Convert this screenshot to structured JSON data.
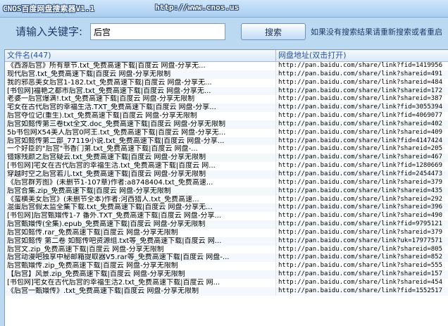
{
  "window": {
    "title": "CNOS百度网盘搜索器V1.1",
    "url": "http://www.cnos.us"
  },
  "search": {
    "label": "请输入关键字:",
    "value": "后宫",
    "button_label": "搜索",
    "hint": "如果没有搜索结果请重新搜索或者重启"
  },
  "table": {
    "col_name": "文件名(447)",
    "col_url": "网盘地址(双击打开)",
    "rows": [
      {
        "name": "《西游后宫》所有章节.txt_免费高速下载|百度云 网盘-分享无...",
        "url": "http://pan.baidu.com/share/link?fid=1419956"
      },
      {
        "name": "现代后宫.txt_免费高速下载|百度云 网盘-分享无限制",
        "url": "http://pan.baidu.com/share/link?shareid=491"
      },
      {
        "name": "我的邪恶美女后宫1-182.txt_免费高速下载|百度云 网盘-分享无...",
        "url": "http://pan.baidu.com/share/link?shareid=484"
      },
      {
        "name": "[书包网]福艳之都市后宫.txt_免费高速下载|百度云 网盘-分享无...",
        "url": "http://pan.baidu.com/share/link?shareid=172"
      },
      {
        "name": "老婆一后宫爆满!.txt_免费高速下载|百度云 网盘-分享无限制",
        "url": "http://pan.baidu.com/share/link?shareid=387"
      },
      {
        "name": "宅女在古代后宫的幸福生活.TXT_免费高速下载|百度云 网盘-分享...",
        "url": "http://pan.baidu.com/share/link?fid=3055394"
      },
      {
        "name": "后宫夺位记(重生).txt_免费高速下载|百度云 网盘-分享无限制",
        "url": "http://pan.baidu.com/share/link?fid=4069077"
      },
      {
        "name": "后宫如懿传第三卷txt全文.doc_免费高速下载|百度云 网盘-分享无限制",
        "url": "http://pan.baidu.com/share/link?shareid=402"
      },
      {
        "name": "5b书包网X54美人后宫0阿王.txt_免费高速下载|百度云 网盘-分享无...",
        "url": "http://pan.baidu.com/share/link?shareid=409"
      },
      {
        "name": "后宫如懿传第二部_77119小说.txt_免费高速下载|百度云 网盘-分享...",
        "url": "http://pan.baidu.com/share/link?fid=4147424"
      },
      {
        "name": "一个好臣的\"后宫\"书香门第.txt_免费高速下载|百度云 网盘-...",
        "url": "http://pan.baidu.com/share/link?shareid=205"
      },
      {
        "name": "错嫁残颜之后宫疑云.txt_免费高速下载|百度云 网盘-分享无限制",
        "url": "http://pan.baidu.com/share/link?shareid=467"
      },
      {
        "name": "[书包网]宅女在古代后宫的幸福生活.txt_免费高速下载|百度云 网...",
        "url": "http://pan.baidu.com/share/link?fid=1280669"
      },
      {
        "name": "穿越时空之后宫若儿.txt_免费高速下载|百度云 网盘-分享无限制",
        "url": "http://pan.baidu.com/share/link?fid=2454473"
      },
      {
        "name": "《后宫群芳图》(未删节1-107章)作者:a8748404.txt_免费高速...",
        "url": "http://pan.baidu.com/share/link?shareid=379"
      },
      {
        "name": "后宫合集.zip_免费高速下载|百度云 网盘-分享无限制",
        "url": "http://pan.baidu.com/share/link?shareid=435"
      },
      {
        "name": "《蛮横美女后宫》(未删节全本)作者:河西猎人.txt_免费高速...",
        "url": "http://pan.baidu.com/share/link?shareid=292"
      },
      {
        "name": "混蛋后宫假太监全集下载.txt_免费高速下载|百度云 网盘-分享无...",
        "url": "http://pan.baidu.com/share/link?shareid=396"
      },
      {
        "name": "[书包网]后宫甄嬛传1-7 番外.TXT_免费高速下载|百度云 网盘-分享...",
        "url": "http://pan.baidu.com/share/link?shareid=490"
      },
      {
        "name": "后宫甄嬛传(全集).epub_免费高速下载|百度云 网盘-分享无限制",
        "url": "http://pan.baidu.com/share/link?fid=9795121"
      },
      {
        "name": "后宫如懿传.rar_免费高速下载|百度云 网盘-分享无限制",
        "url": "http://pan.baidu.com/share/link?shareid=379"
      },
      {
        "name": "后宫如懿传 第二卷 如懿传吧资源组.txt等_免费高速下载|百度云 网...",
        "url": "http://pan.baidu.com/share/link?uk=17977571"
      },
      {
        "name": "后宫文.zip_免费高速下载|百度云 网盘-分享无限制",
        "url": "http://pan.baidu.com/share/link?shareid=805"
      },
      {
        "name": "后宫动漫吧独享中秘邮箱提取器V5.rar等_免费高速下载|百度云 网盘-...",
        "url": "http://pan.baidu.com/share/link?shareid=852"
      },
      {
        "name": "后宫甄嬛传.zip_免费高速下载|百度云 网盘-分享无限制",
        "url": "http://pan.baidu.com/share/link?shareid=555"
      },
      {
        "name": "【后宫】风景.zip_免费高速下载|百度云 网盘-分享无限制",
        "url": "http://pan.baidu.com/share/link?shareid=157"
      },
      {
        "name": "[书包网]宅女在古代后宫的幸福生活2.txt_免费高速下载|百度云 网...",
        "url": "http://pan.baidu.com/share/link?shareid=454"
      },
      {
        "name": "《后宫一甄嬛传》.txt_免费高速下载|百度云 网盘-分享无限制",
        "url": "http://pan.baidu.com/share/link?fid=1552517"
      }
    ]
  }
}
